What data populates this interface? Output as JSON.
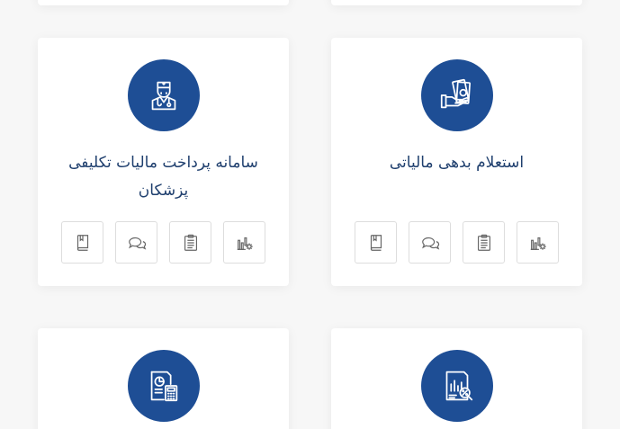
{
  "cards": [
    {
      "title": "استعلام بدهی مالیاتی",
      "icon": "money-hand-icon",
      "actions": [
        "book-icon",
        "comment-icon",
        "clipboard-icon",
        "chart-settings-icon"
      ]
    },
    {
      "title": "سامانه پرداخت مالیات تکلیفی پزشکان",
      "icon": "doctor-icon",
      "actions": [
        "book-icon",
        "comment-icon",
        "clipboard-icon",
        "chart-settings-icon"
      ]
    },
    {
      "title": "",
      "icon": "report-percent-icon"
    },
    {
      "title": "",
      "icon": "calculator-report-icon"
    }
  ],
  "colors": {
    "brand": "#1e4e95",
    "title": "#1f3f6e",
    "icon_gray": "#666666",
    "background": "#f7f7f7"
  }
}
